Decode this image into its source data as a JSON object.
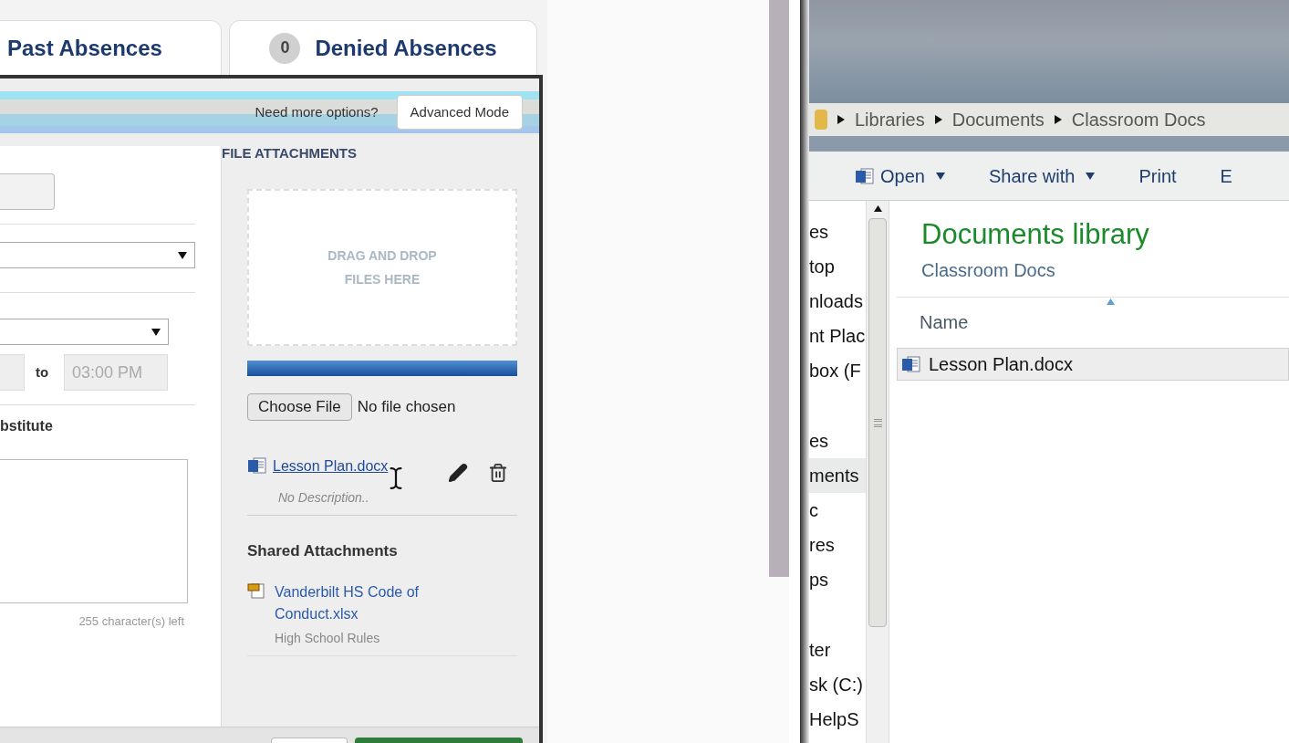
{
  "tabs": [
    {
      "label": "Past Absences",
      "selected": false
    },
    {
      "label": "Denied Absences",
      "badge": "0",
      "selected": false
    }
  ],
  "dialog": {
    "header": {
      "prompt": "Need more options?",
      "button": "Advanced Mode"
    },
    "form": {
      "time_to_label": "to",
      "time_to_value": "03:00 PM",
      "substitute_label": "bstitute",
      "chars_left": "255 character(s) left"
    },
    "attachments": {
      "title": "FILE ATTACHMENTS",
      "dropzone": "DRAG AND DROP FILES HERE",
      "upload": {
        "level": 1
      },
      "choose_button": "Choose File",
      "no_file": "No file chosen",
      "files": [
        {
          "name": "Lesson Plan.docx",
          "description": "No Description.."
        }
      ],
      "shared_title": "Shared Attachments",
      "shared": [
        {
          "name": "Vanderbilt HS Code of Conduct.xlsx",
          "description": "High School Rules"
        }
      ]
    }
  },
  "explorer": {
    "breadcrumbs": [
      "Libraries",
      "Documents",
      "Classroom Docs"
    ],
    "toolbar": [
      {
        "label": "Open",
        "dropdown": true
      },
      {
        "label": "Share with",
        "dropdown": true
      },
      {
        "label": "Print",
        "dropdown": false
      },
      {
        "label": "E",
        "dropdown": false
      }
    ],
    "nav_groups": [
      [
        {
          "label": "es",
          "selected": false
        },
        {
          "label": "top",
          "selected": false
        },
        {
          "label": "nloads",
          "selected": false
        },
        {
          "label": "nt Plac",
          "selected": false
        },
        {
          "label": "box (F",
          "selected": false
        }
      ],
      [
        {
          "label": "es",
          "selected": false
        },
        {
          "label": "ments",
          "selected": true
        },
        {
          "label": "c",
          "selected": false
        },
        {
          "label": "res",
          "selected": false
        },
        {
          "label": "ps",
          "selected": false
        }
      ],
      [
        {
          "label": "ter",
          "selected": false
        },
        {
          "label": "sk (C:)",
          "selected": false
        },
        {
          "label": "HelpS",
          "selected": false
        }
      ]
    ],
    "title": "Documents library",
    "subtitle": "Classroom Docs",
    "column": "Name",
    "files": [
      {
        "name": "Lesson Plan.docx",
        "selected": true
      }
    ]
  }
}
